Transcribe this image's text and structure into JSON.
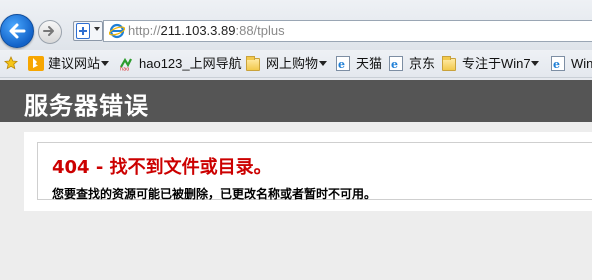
{
  "browser": {
    "address": {
      "prefix": "http://",
      "host": "211.103.3.89",
      "rest": ":88/tplus"
    },
    "favorites": [
      {
        "label": "建议网站",
        "icon": "bing-icon",
        "dropdown": true
      },
      {
        "label": "hao123_上网导航",
        "icon": "hao123-icon",
        "dropdown": false
      },
      {
        "label": "网上购物",
        "icon": "folder-icon",
        "dropdown": true
      },
      {
        "label": "天猫",
        "icon": "ie-page-icon",
        "dropdown": false
      },
      {
        "label": "京东",
        "icon": "ie-page-icon",
        "dropdown": false
      },
      {
        "label": "专注于Win7",
        "icon": "folder-icon",
        "dropdown": true
      },
      {
        "label": "Win",
        "icon": "ie-page-icon",
        "dropdown": false
      }
    ]
  },
  "page": {
    "title": "服务器错误",
    "error_code": "404 - 找不到文件或目录。",
    "error_message": "您要查找的资源可能已被删除，已更改名称或者暂时不可用。"
  },
  "colors": {
    "header_bg": "#555555",
    "error_red": "#cc0000",
    "page_bg": "#ededed"
  }
}
